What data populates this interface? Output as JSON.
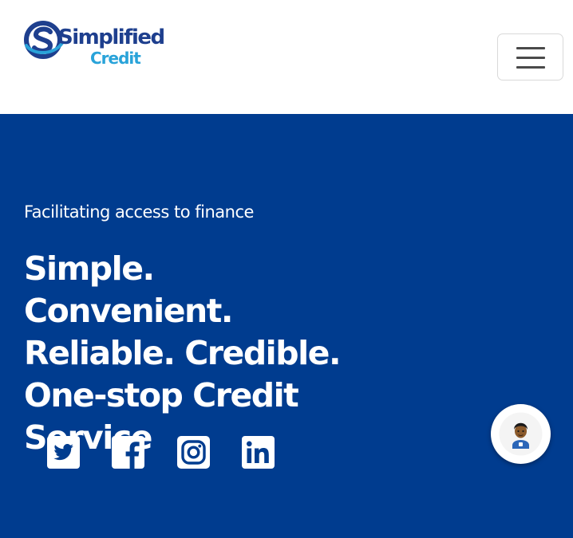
{
  "brand": {
    "logo_word_1": "Simplified",
    "logo_word_2": "Credit",
    "primary_color": "#1e3f8e",
    "accent_color": "#29a3d9"
  },
  "navbar": {
    "menu_toggle_icon": "hamburger-icon"
  },
  "hero": {
    "background_color": "#003c8f",
    "tagline": "Facilitating access to finance",
    "headline": "Simple. Convenient. Reliable. Credible. One-stop Credit Service"
  },
  "social": [
    {
      "icon": "twitter-icon"
    },
    {
      "icon": "facebook-icon"
    },
    {
      "icon": "instagram-icon"
    },
    {
      "icon": "linkedin-icon"
    }
  ],
  "chat": {
    "icon": "chat-avatar-icon"
  }
}
